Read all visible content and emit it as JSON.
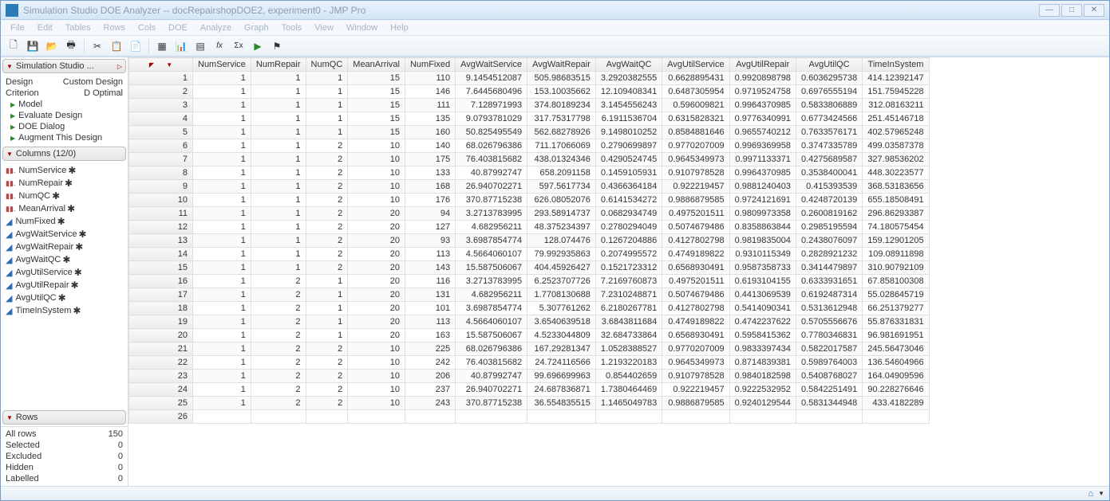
{
  "window": {
    "title": "Simulation Studio DOE Analyzer -- docRepairshopDOE2, experiment0 - JMP Pro"
  },
  "menus": [
    "File",
    "Edit",
    "Tables",
    "Rows",
    "Cols",
    "DOE",
    "Analyze",
    "Graph",
    "Tools",
    "View",
    "Window",
    "Help"
  ],
  "design_panel": {
    "title": "Simulation Studio ...",
    "rows": [
      {
        "l": "Design",
        "r": "Custom Design"
      },
      {
        "l": "Criterion",
        "r": "D Optimal"
      }
    ],
    "items": [
      "Model",
      "Evaluate Design",
      "DOE Dialog",
      "Augment This Design"
    ]
  },
  "columns_panel": {
    "title": "Columns (12/0)",
    "items": [
      {
        "name": "NumService",
        "icon": "hist",
        "star": true
      },
      {
        "name": "NumRepair",
        "icon": "hist",
        "star": true
      },
      {
        "name": "NumQC",
        "icon": "hist",
        "star": true
      },
      {
        "name": "MeanArrival",
        "icon": "hist",
        "star": true
      },
      {
        "name": "NumFixed",
        "icon": "tri",
        "star": true
      },
      {
        "name": "AvgWaitService",
        "icon": "tri",
        "star": true
      },
      {
        "name": "AvgWaitRepair",
        "icon": "tri",
        "star": true
      },
      {
        "name": "AvgWaitQC",
        "icon": "tri",
        "star": true
      },
      {
        "name": "AvgUtilService",
        "icon": "tri",
        "star": true
      },
      {
        "name": "AvgUtilRepair",
        "icon": "tri",
        "star": true
      },
      {
        "name": "AvgUtilQC",
        "icon": "tri",
        "star": true
      },
      {
        "name": "TimeInSystem",
        "icon": "tri",
        "star": true
      }
    ]
  },
  "rows_panel": {
    "title": "Rows",
    "items": [
      {
        "l": "All rows",
        "r": "150"
      },
      {
        "l": "Selected",
        "r": "0"
      },
      {
        "l": "Excluded",
        "r": "0"
      },
      {
        "l": "Hidden",
        "r": "0"
      },
      {
        "l": "Labelled",
        "r": "0"
      }
    ]
  },
  "table": {
    "headers": [
      "NumService",
      "NumRepair",
      "NumQC",
      "MeanArrival",
      "NumFixed",
      "AvgWaitService",
      "AvgWaitRepair",
      "AvgWaitQC",
      "AvgUtilService",
      "AvgUtilRepair",
      "AvgUtilQC",
      "TimeInSystem"
    ],
    "rows": [
      [
        "1",
        "1",
        "1",
        "1",
        "15",
        "110",
        "9.1454512087",
        "505.98683515",
        "3.2920382555",
        "0.6628895431",
        "0.9920898798",
        "0.6036295738",
        "414.12392147"
      ],
      [
        "2",
        "1",
        "1",
        "1",
        "15",
        "146",
        "7.6445680496",
        "153.10035662",
        "12.109408341",
        "0.6487305954",
        "0.9719524758",
        "0.6976555194",
        "151.75945228"
      ],
      [
        "3",
        "1",
        "1",
        "1",
        "15",
        "111",
        "7.128971993",
        "374.80189234",
        "3.1454556243",
        "0.596009821",
        "0.9964370985",
        "0.5833806889",
        "312.08163211"
      ],
      [
        "4",
        "1",
        "1",
        "1",
        "15",
        "135",
        "9.0793781029",
        "317.75317798",
        "6.1911536704",
        "0.6315828321",
        "0.9776340991",
        "0.6773424566",
        "251.45146718"
      ],
      [
        "5",
        "1",
        "1",
        "1",
        "15",
        "160",
        "50.825495549",
        "562.68278926",
        "9.1498010252",
        "0.8584881646",
        "0.9655740212",
        "0.7633576171",
        "402.57965248"
      ],
      [
        "6",
        "1",
        "1",
        "2",
        "10",
        "140",
        "68.026796386",
        "711.17066069",
        "0.2790699897",
        "0.9770207009",
        "0.9969369958",
        "0.3747335789",
        "499.03587378"
      ],
      [
        "7",
        "1",
        "1",
        "2",
        "10",
        "175",
        "76.403815682",
        "438.01324346",
        "0.4290524745",
        "0.9645349973",
        "0.9971133371",
        "0.4275689587",
        "327.98536202"
      ],
      [
        "8",
        "1",
        "1",
        "2",
        "10",
        "133",
        "40.87992747",
        "658.2091158",
        "0.1459105931",
        "0.9107978528",
        "0.9964370985",
        "0.3538400041",
        "448.30223577"
      ],
      [
        "9",
        "1",
        "1",
        "2",
        "10",
        "168",
        "26.940702271",
        "597.5617734",
        "0.4366364184",
        "0.922219457",
        "0.9881240403",
        "0.415393539",
        "368.53183656"
      ],
      [
        "10",
        "1",
        "1",
        "2",
        "10",
        "176",
        "370.87715238",
        "626.08052076",
        "0.6141534272",
        "0.9886879585",
        "0.9724121691",
        "0.4248720139",
        "655.18508491"
      ],
      [
        "11",
        "1",
        "1",
        "2",
        "20",
        "94",
        "3.2713783995",
        "293.58914737",
        "0.0682934749",
        "0.4975201511",
        "0.9809973358",
        "0.2600819162",
        "296.86293387"
      ],
      [
        "12",
        "1",
        "1",
        "2",
        "20",
        "127",
        "4.682956211",
        "48.375234397",
        "0.2780294049",
        "0.5074679486",
        "0.8358863844",
        "0.2985195594",
        "74.180575454"
      ],
      [
        "13",
        "1",
        "1",
        "2",
        "20",
        "93",
        "3.6987854774",
        "128.074476",
        "0.1267204886",
        "0.4127802798",
        "0.9819835004",
        "0.2438076097",
        "159.12901205"
      ],
      [
        "14",
        "1",
        "1",
        "2",
        "20",
        "113",
        "4.5664060107",
        "79.992935863",
        "0.2074995572",
        "0.4749189822",
        "0.9310115349",
        "0.2828921232",
        "109.08911898"
      ],
      [
        "15",
        "1",
        "1",
        "2",
        "20",
        "143",
        "15.587506067",
        "404.45926427",
        "0.1521723312",
        "0.6568930491",
        "0.9587358733",
        "0.3414479897",
        "310.90792109"
      ],
      [
        "16",
        "1",
        "2",
        "1",
        "20",
        "116",
        "3.2713783995",
        "6.2523707726",
        "7.2169760873",
        "0.4975201511",
        "0.6193104155",
        "0.6333931651",
        "67.858100308"
      ],
      [
        "17",
        "1",
        "2",
        "1",
        "20",
        "131",
        "4.682956211",
        "1.7708130688",
        "7.2310248871",
        "0.5074679486",
        "0.4413069539",
        "0.6192487314",
        "55.028645719"
      ],
      [
        "18",
        "1",
        "2",
        "1",
        "20",
        "101",
        "3.6987854774",
        "5.307761262",
        "6.2180267781",
        "0.4127802798",
        "0.5414090341",
        "0.5313612948",
        "66.251379277"
      ],
      [
        "19",
        "1",
        "2",
        "1",
        "20",
        "113",
        "4.5664060107",
        "3.6540639518",
        "3.6843811684",
        "0.4749189822",
        "0.4742237622",
        "0.5705556676",
        "55.876331831"
      ],
      [
        "20",
        "1",
        "2",
        "1",
        "20",
        "163",
        "15.587506067",
        "4.5233044809",
        "32.684733864",
        "0.6568930491",
        "0.5958415362",
        "0.7780346831",
        "96.981691951"
      ],
      [
        "21",
        "1",
        "2",
        "2",
        "10",
        "225",
        "68.026796386",
        "167.29281347",
        "1.0528388527",
        "0.9770207009",
        "0.9833397434",
        "0.5822017587",
        "245.56473046"
      ],
      [
        "22",
        "1",
        "2",
        "2",
        "10",
        "242",
        "76.403815682",
        "24.724116566",
        "1.2193220183",
        "0.9645349973",
        "0.8714839381",
        "0.5989764003",
        "136.54604966"
      ],
      [
        "23",
        "1",
        "2",
        "2",
        "10",
        "206",
        "40.87992747",
        "99.696699963",
        "0.854402659",
        "0.9107978528",
        "0.9840182598",
        "0.5408768027",
        "164.04909596"
      ],
      [
        "24",
        "1",
        "2",
        "2",
        "10",
        "237",
        "26.940702271",
        "24.687836871",
        "1.7380464469",
        "0.922219457",
        "0.9222532952",
        "0.5842251491",
        "90.228276646"
      ],
      [
        "25",
        "1",
        "2",
        "2",
        "10",
        "243",
        "370.87715238",
        "36.554835515",
        "1.1465049783",
        "0.9886879585",
        "0.9240129544",
        "0.5831344948",
        "433.4182289"
      ],
      [
        "26",
        "",
        "",
        "",
        "",
        "",
        "",
        "",
        "",
        "",
        "",
        "",
        ""
      ]
    ]
  }
}
